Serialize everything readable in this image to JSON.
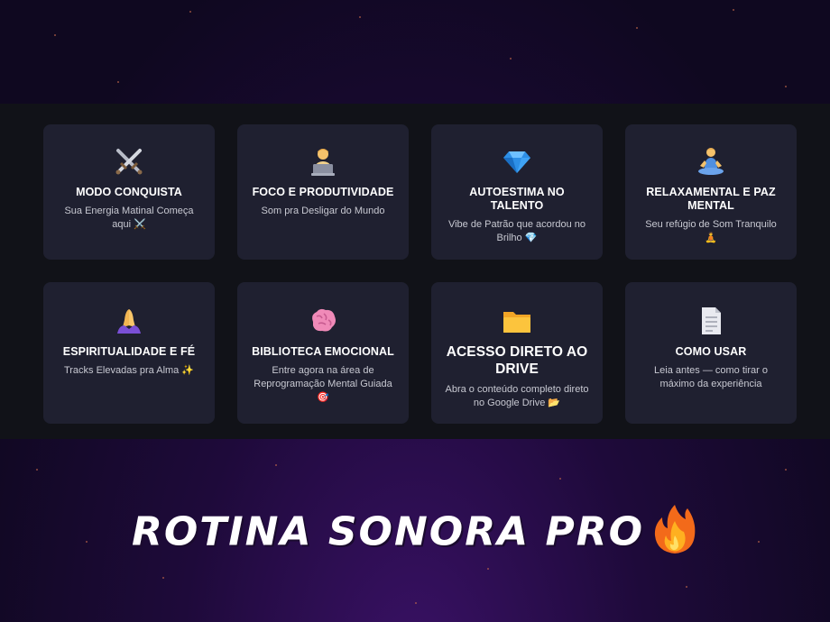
{
  "cards": [
    {
      "icon": "crossed-swords-icon",
      "title": "MODO CONQUISTA",
      "desc": "Sua Energia Matinal Começa aqui ⚔️"
    },
    {
      "icon": "person-laptop-icon",
      "title": "FOCO E PRODUTIVIDADE",
      "desc": "Som pra Desligar do Mundo"
    },
    {
      "icon": "diamond-icon",
      "title": "AUTOESTIMA NO TALENTO",
      "desc": "Vibe de Patrão que acordou no Brilho 💎"
    },
    {
      "icon": "meditation-icon",
      "title": "RELAXAMENTAL E PAZ MENTAL",
      "desc": "Seu refúgio de Som Tranquilo 🧘"
    },
    {
      "icon": "praying-hands-icon",
      "title": "ESPIRITUALIDADE E FÉ",
      "desc": "Tracks Elevadas pra Alma ✨"
    },
    {
      "icon": "brain-icon",
      "title": "BIBLIOTECA EMOCIONAL",
      "desc": "Entre agora na área de Reprogramação Mental Guiada 🎯"
    },
    {
      "icon": "folder-icon",
      "title": "ACESSO DIRETO AO DRIVE",
      "desc": "Abra o conteúdo completo direto no Google Drive 📂"
    },
    {
      "icon": "document-icon",
      "title": "COMO USAR",
      "desc": "Leia antes — como tirar o máximo da experiência"
    }
  ],
  "brand": {
    "title": "ROTINA SONORA PRO",
    "icon": "fire-icon"
  }
}
